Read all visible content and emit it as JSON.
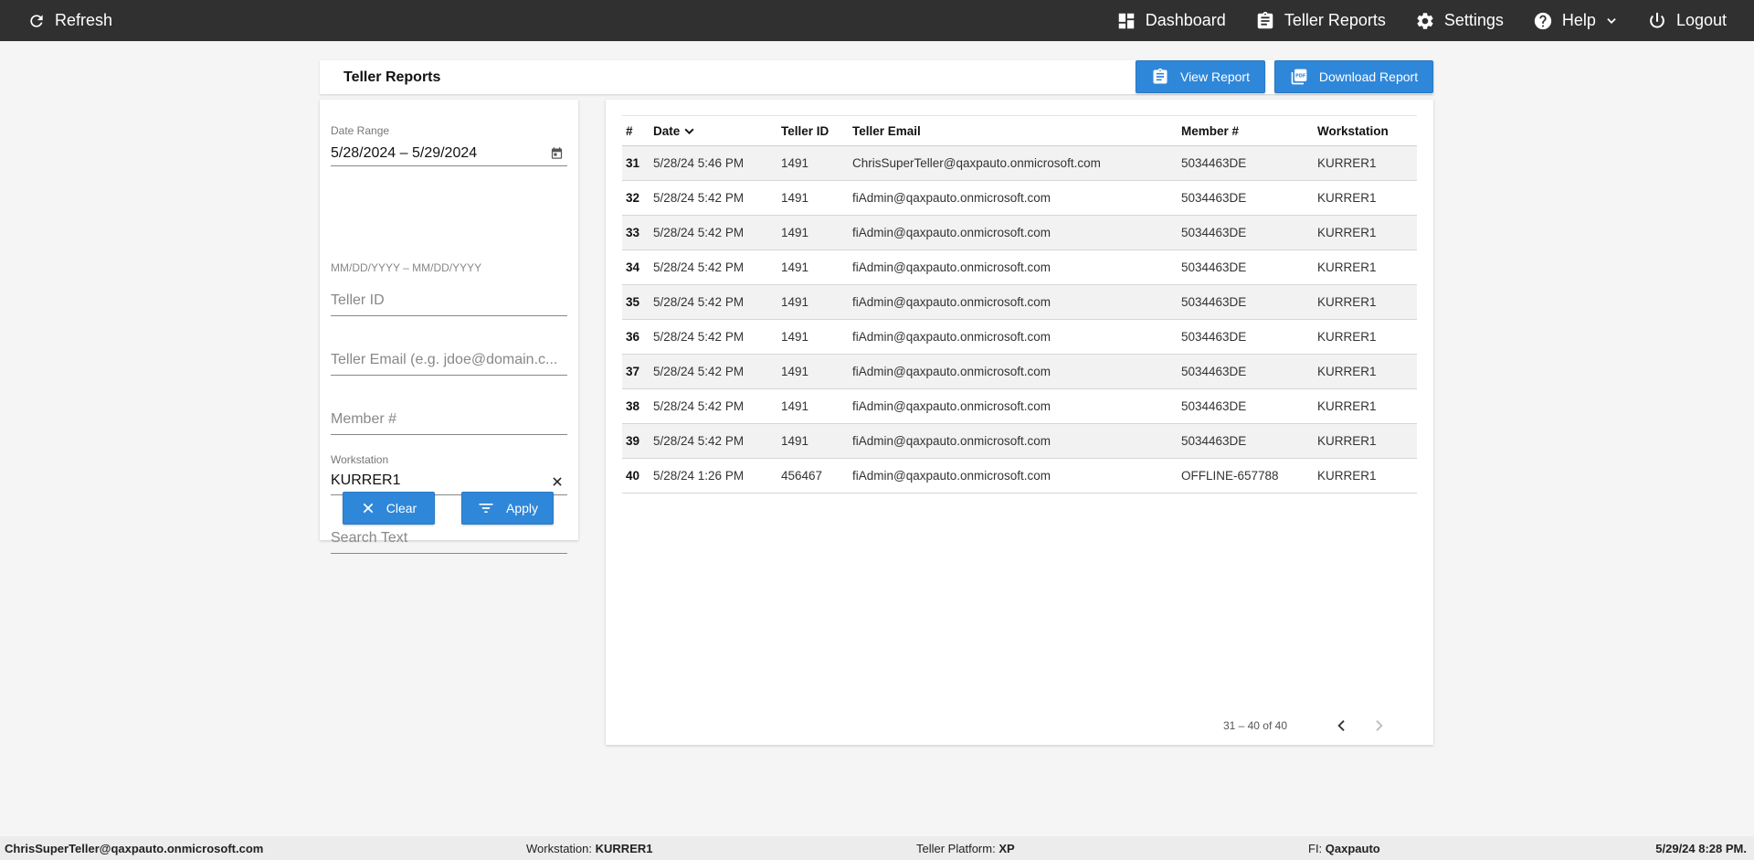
{
  "topbar": {
    "refresh_label": "Refresh",
    "nav": [
      {
        "label": "Dashboard",
        "icon": "dashboard-icon"
      },
      {
        "label": "Teller Reports",
        "icon": "clipboard-icon"
      },
      {
        "label": "Settings",
        "icon": "gear-icon"
      },
      {
        "label": "Help",
        "icon": "help-icon"
      },
      {
        "label": "Logout",
        "icon": "power-icon"
      }
    ]
  },
  "header": {
    "title": "Teller Reports",
    "view_report_label": "View Report",
    "download_report_label": "Download Report"
  },
  "filters": {
    "date_range_label": "Date Range",
    "date_range_value": "5/28/2024 – 5/29/2024",
    "date_hint": "MM/DD/YYYY – MM/DD/YYYY",
    "teller_id_placeholder": "Teller ID",
    "teller_email_placeholder": "Teller Email (e.g. jdoe@domain.c...",
    "member_placeholder": "Member #",
    "workstation_label": "Workstation",
    "workstation_value": "KURRER1",
    "search_placeholder": "Search Text",
    "clear_label": "Clear",
    "apply_label": "Apply"
  },
  "table": {
    "headers": [
      "#",
      "Date",
      "Teller ID",
      "Teller Email",
      "Member #",
      "Workstation"
    ],
    "rows": [
      {
        "num": "31",
        "date": "5/28/24 5:46 PM",
        "teller_id": "1491",
        "email": "ChrisSuperTeller@qaxpauto.onmicrosoft.com",
        "member": "5034463DE",
        "workstation": "KURRER1"
      },
      {
        "num": "32",
        "date": "5/28/24 5:42 PM",
        "teller_id": "1491",
        "email": "fiAdmin@qaxpauto.onmicrosoft.com",
        "member": "5034463DE",
        "workstation": "KURRER1"
      },
      {
        "num": "33",
        "date": "5/28/24 5:42 PM",
        "teller_id": "1491",
        "email": "fiAdmin@qaxpauto.onmicrosoft.com",
        "member": "5034463DE",
        "workstation": "KURRER1"
      },
      {
        "num": "34",
        "date": "5/28/24 5:42 PM",
        "teller_id": "1491",
        "email": "fiAdmin@qaxpauto.onmicrosoft.com",
        "member": "5034463DE",
        "workstation": "KURRER1"
      },
      {
        "num": "35",
        "date": "5/28/24 5:42 PM",
        "teller_id": "1491",
        "email": "fiAdmin@qaxpauto.onmicrosoft.com",
        "member": "5034463DE",
        "workstation": "KURRER1"
      },
      {
        "num": "36",
        "date": "5/28/24 5:42 PM",
        "teller_id": "1491",
        "email": "fiAdmin@qaxpauto.onmicrosoft.com",
        "member": "5034463DE",
        "workstation": "KURRER1"
      },
      {
        "num": "37",
        "date": "5/28/24 5:42 PM",
        "teller_id": "1491",
        "email": "fiAdmin@qaxpauto.onmicrosoft.com",
        "member": "5034463DE",
        "workstation": "KURRER1"
      },
      {
        "num": "38",
        "date": "5/28/24 5:42 PM",
        "teller_id": "1491",
        "email": "fiAdmin@qaxpauto.onmicrosoft.com",
        "member": "5034463DE",
        "workstation": "KURRER1"
      },
      {
        "num": "39",
        "date": "5/28/24 5:42 PM",
        "teller_id": "1491",
        "email": "fiAdmin@qaxpauto.onmicrosoft.com",
        "member": "5034463DE",
        "workstation": "KURRER1"
      },
      {
        "num": "40",
        "date": "5/28/24 1:26 PM",
        "teller_id": "456467",
        "email": "fiAdmin@qaxpauto.onmicrosoft.com",
        "member": "OFFLINE-657788",
        "workstation": "KURRER1"
      }
    ],
    "paginator_range": "31 – 40 of 40"
  },
  "footer": {
    "user": "ChrisSuperTeller@qaxpauto.onmicrosoft.com",
    "workstation_label": "Workstation:",
    "workstation_value": "KURRER1",
    "platform_label": "Teller Platform:",
    "platform_value": "XP",
    "fi_label": "FI:",
    "fi_value": "Qaxpauto",
    "datetime": "5/29/24 8:28 PM."
  },
  "colors": {
    "topbar": "#303030",
    "accent_button": "#2f87d9",
    "background": "#f5f5f5"
  }
}
